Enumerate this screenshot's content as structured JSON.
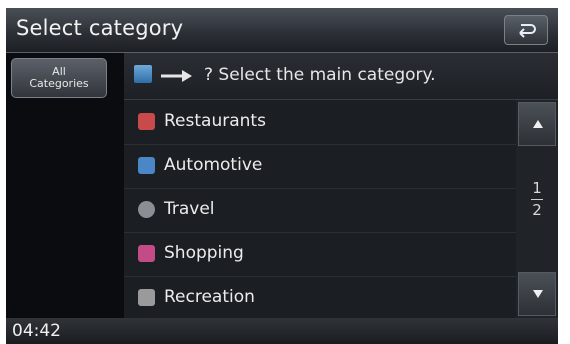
{
  "header": {
    "title": "Select category"
  },
  "sidebar": {
    "all_categories_line1": "All",
    "all_categories_line2": "Categories"
  },
  "prompt": {
    "text": "? Select the main category."
  },
  "categories": [
    {
      "label": "Restaurants",
      "icon": "restaurant-icon",
      "color": "#c94a4a"
    },
    {
      "label": "Automotive",
      "icon": "car-icon",
      "color": "#4b86c6"
    },
    {
      "label": "Travel",
      "icon": "globe-icon",
      "color": "#8a8f96"
    },
    {
      "label": "Shopping",
      "icon": "shopping-bag-icon",
      "color": "#c24b88"
    },
    {
      "label": "Recreation",
      "icon": "recreation-icon",
      "color": "#9a9a9a"
    }
  ],
  "pager": {
    "current": "1",
    "total": "2"
  },
  "status": {
    "time": "04:42"
  },
  "colors": {
    "background": "#0d0f12",
    "text": "#ececec",
    "button": "#3c4047"
  }
}
